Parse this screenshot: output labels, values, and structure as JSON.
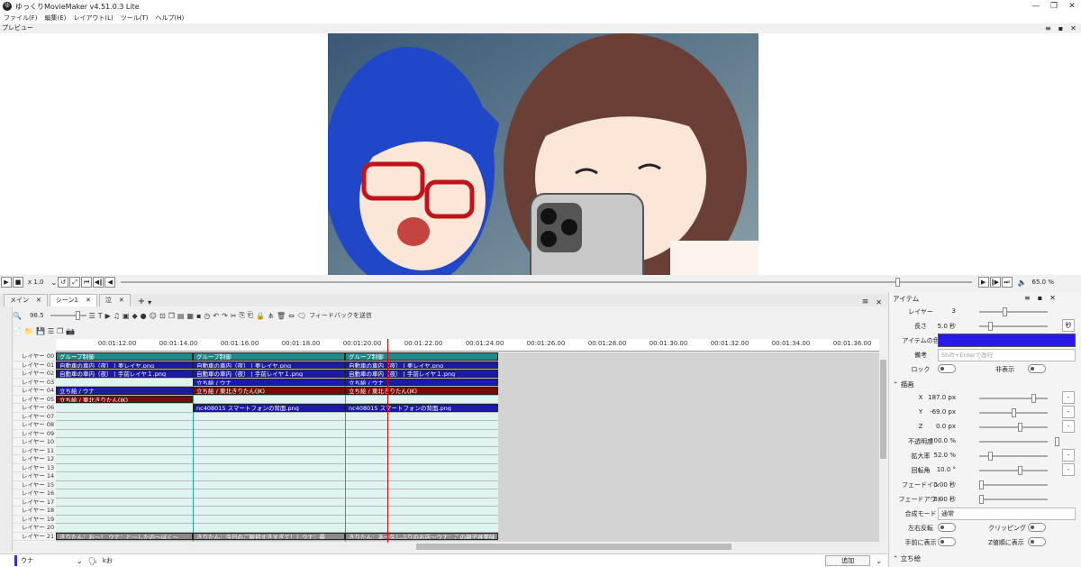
{
  "window": {
    "title": "ゆっくりMovieMaker v4.51.0.3 Lite"
  },
  "menu": [
    "ファイル(F)",
    "編集(E)",
    "レイアウト(L)",
    "ツール(T)",
    "ヘルプ(H)"
  ],
  "preview": {
    "label": "プレビュー",
    "zoom": "65.0 %"
  },
  "playback": {
    "speed": "x 1.0"
  },
  "tabs": [
    {
      "label": "メイン"
    },
    {
      "label": "シーン1"
    },
    {
      "label": "泣"
    }
  ],
  "timeline": {
    "zoom": "98.5",
    "feedback_label": "フィードバックを送信",
    "ticks": [
      "00:01:12.00",
      "00:01:14.00",
      "00:01:16.00",
      "00:01:18.00",
      "00:01:20.00",
      "00:01:22.00",
      "00:01:24.00",
      "00:01:26.00",
      "00:01:28.00",
      "00:01:30.00",
      "00:01:32.00",
      "00:01:34.00",
      "00:01:36.00"
    ],
    "layers": [
      "レイヤー 00",
      "レイヤー 01",
      "レイヤー 02",
      "レイヤー 03",
      "レイヤー 04",
      "レイヤー 05",
      "レイヤー 06",
      "レイヤー 07",
      "レイヤー 08",
      "レイヤー 09",
      "レイヤー 10",
      "レイヤー 11",
      "レイヤー 12",
      "レイヤー 13",
      "レイヤー 14",
      "レイヤー 15",
      "レイヤー 16",
      "レイヤー 17",
      "レイヤー 18",
      "レイヤー 19",
      "レイヤー 20",
      "レイヤー 21"
    ],
    "clips": [
      {
        "layer": 0,
        "start": 0,
        "end": 152,
        "text": "グループ制御",
        "color": "#1f8a8a"
      },
      {
        "layer": 0,
        "start": 152,
        "end": 321,
        "text": "グループ制御",
        "color": "#1f8a8a"
      },
      {
        "layer": 0,
        "start": 321,
        "end": 491,
        "text": "グループ制御",
        "color": "#1f8a8a"
      },
      {
        "layer": 1,
        "start": 0,
        "end": 152,
        "text": "自動車の車内（夜） | 奥レイヤ.png",
        "color": "#1a1aa6"
      },
      {
        "layer": 1,
        "start": 152,
        "end": 321,
        "text": "自動車の車内（夜） | 奥レイヤ.png",
        "color": "#1a1aa6"
      },
      {
        "layer": 1,
        "start": 321,
        "end": 491,
        "text": "自動車の車内（夜） | 奥レイヤ.png",
        "color": "#1a1aa6"
      },
      {
        "layer": 2,
        "start": 0,
        "end": 152,
        "text": "自動車の車内（夜） | 手前レイヤ１.png",
        "color": "#1a1aa6"
      },
      {
        "layer": 2,
        "start": 152,
        "end": 321,
        "text": "自動車の車内（夜） | 手前レイヤ１.png",
        "color": "#1a1aa6"
      },
      {
        "layer": 2,
        "start": 321,
        "end": 491,
        "text": "自動車の車内（夜） | 手前レイヤ１.png",
        "color": "#1a1aa6"
      },
      {
        "layer": 3,
        "start": 152,
        "end": 321,
        "text": "立ち絵 / ウナ",
        "color": "#1a1aa6"
      },
      {
        "layer": 3,
        "start": 321,
        "end": 491,
        "text": "立ち絵 / ウナ",
        "color": "#1a1aa6"
      },
      {
        "layer": 4,
        "start": 0,
        "end": 152,
        "text": "立ち絵 / ウナ",
        "color": "#1a1aa6"
      },
      {
        "layer": 4,
        "start": 152,
        "end": 321,
        "text": "立ち絵 / 東北きりたん(JK)",
        "color": "#7a0a0a"
      },
      {
        "layer": 4,
        "start": 321,
        "end": 491,
        "text": "立ち絵 / 東北きりたん(JK)",
        "color": "#7a0a0a"
      },
      {
        "layer": 5,
        "start": 0,
        "end": 152,
        "text": "立ち絵 / 東北きりたん(JK)",
        "color": "#7a0a0a"
      },
      {
        "layer": 6,
        "start": 152,
        "end": 321,
        "text": "nc408015 スマートフォンの背面.png",
        "color": "#1a1aa6"
      },
      {
        "layer": 6,
        "start": 321,
        "end": 491,
        "text": "nc408015 スマートフォンの背面.png",
        "color": "#1a1aa6"
      },
      {
        "layer": 21,
        "start": 0,
        "end": 152,
        "text": "きりたん：お〜！ ウナ：と〜したの〜ほく〜",
        "color": "#8a8a8a"
      },
      {
        "layer": 21,
        "start": 152,
        "end": 321,
        "text": "きりたん：今日のご飯何すきすぎて！！ウナ：最",
        "color": "#8a8a8a"
      },
      {
        "layer": 21,
        "start": 321,
        "end": 491,
        "text": "きりたん：あ〜久しぶりのお店〜ウナ：この親子丼美味",
        "color": "#8a8a8a"
      }
    ]
  },
  "bottom": {
    "character": "ウナ",
    "input": "kお",
    "add_button": "追加"
  },
  "item_panel": {
    "title": "アイテム",
    "layer_label": "レイヤー",
    "layer_value": "3",
    "length_label": "長さ",
    "length_value": "5.0 秒",
    "length_unit": "秒",
    "color_label": "アイテムの色",
    "color_value": "#2a1ae8",
    "note_label": "備考",
    "note_placeholder": "Shift+Enterで改行",
    "lock_label": "ロック",
    "hidden_label": "非表示",
    "draw_section": "描画",
    "x_label": "X",
    "x_value": "187.0 px",
    "y_label": "Y",
    "y_value": "-69.0 px",
    "z_label": "Z",
    "z_value": "0.0 px",
    "opacity_label": "不透明度",
    "opacity_value": "100.0 %",
    "scale_label": "拡大率",
    "scale_value": "52.0 %",
    "rotate_label": "回転角",
    "rotate_value": "10.0 °",
    "fadein_label": "フェードイン",
    "fadein_value": "0.00 秒",
    "fadeout_label": "フェードアウト",
    "fadeout_value": "0.00 秒",
    "blend_label": "合成モード",
    "blend_value": "通常",
    "flip_label": "左右反転",
    "clip_label": "クリッピング",
    "front_label": "手前に表示",
    "zorder_label": "Z値順に表示",
    "standing_section": "立ち絵"
  }
}
